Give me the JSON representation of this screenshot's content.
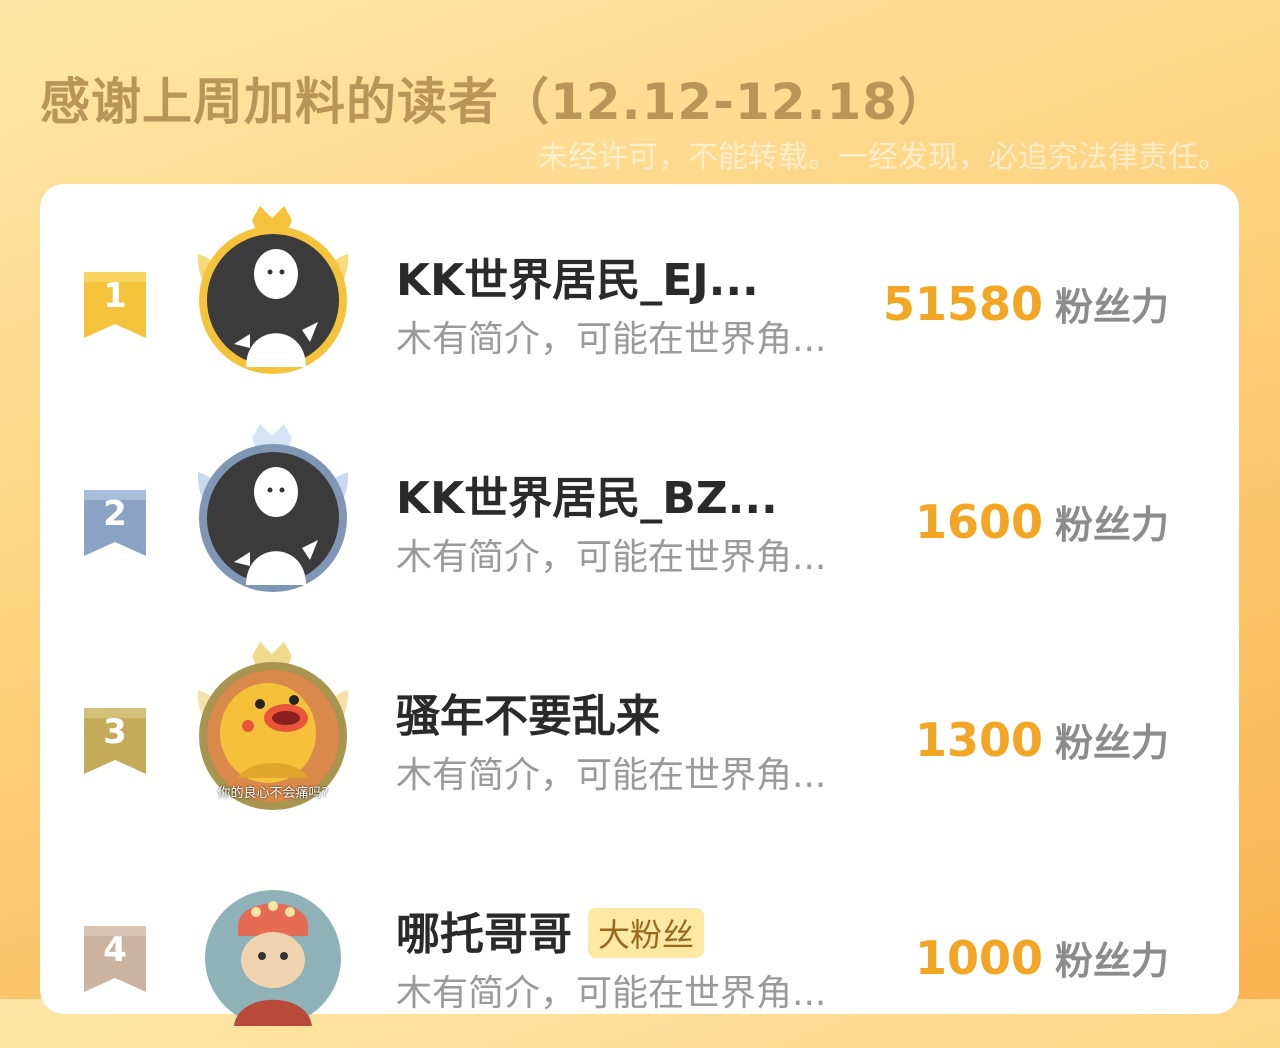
{
  "header": {
    "title": "感谢上周加料的读者（12.12-12.18）",
    "watermark": "未经许可，不能转载。一经发现，必追究法律责任。"
  },
  "colors": {
    "gold": "#f5c33b",
    "silver": "#7f96b4",
    "bronze": "#cbb25f",
    "fourth": "#cfb7a5",
    "score": "#f3a623"
  },
  "ranking": [
    {
      "rank": "1",
      "name": "KK世界居民_EJ...",
      "intro": "木有简介，可能在世界角...",
      "score": "51580",
      "unit": "粉丝力",
      "tag": "",
      "avatar": "default-avatar-icon",
      "frame": "gold-crown-wings"
    },
    {
      "rank": "2",
      "name": "KK世界居民_BZ...",
      "intro": "木有简介，可能在世界角...",
      "score": "1600",
      "unit": "粉丝力",
      "tag": "",
      "avatar": "default-avatar-icon",
      "frame": "silver-crown-wings"
    },
    {
      "rank": "3",
      "name": "骚年不要乱来",
      "intro": "木有简介，可能在世界角...",
      "score": "1300",
      "unit": "粉丝力",
      "tag": "",
      "avatar": "yellow-chick-avatar",
      "avatar_caption": "你的良心不会痛吗?",
      "frame": "bronze-crown-wings"
    },
    {
      "rank": "4",
      "name": "哪托哥哥",
      "intro": "木有简介，可能在世界角...",
      "score": "1000",
      "unit": "粉丝力",
      "tag": "大粉丝",
      "avatar": "cat-costume-avatar",
      "frame": "none"
    }
  ]
}
